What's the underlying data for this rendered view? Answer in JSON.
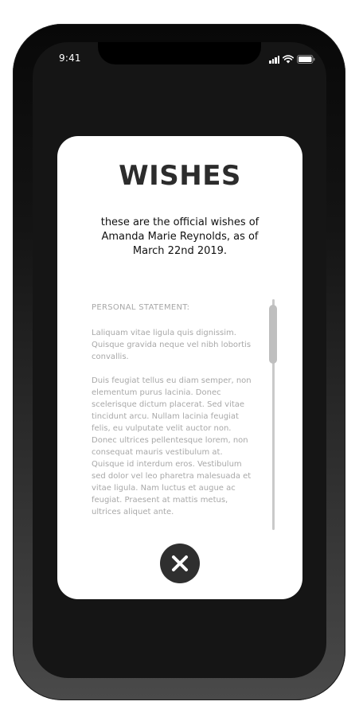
{
  "status_bar": {
    "time": "9:41",
    "signal_icon": "cellular-signal-icon",
    "wifi_icon": "wifi-icon",
    "battery_icon": "battery-icon"
  },
  "modal": {
    "title": "WISHES",
    "subtitle": "these are the official wishes of Amanda Marie Reynolds, as of March 22nd 2019.",
    "statement_heading": "PERSONAL STATEMENT:",
    "paragraphs": [
      "Laliquam vitae ligula quis dignissim. Quisque gravida neque vel nibh lobortis convallis.",
      "Duis feugiat tellus eu diam semper, non elementum purus lacinia. Donec scelerisque dictum placerat. Sed vitae tincidunt arcu. Nullam lacinia feugiat felis, eu vulputate velit auctor non. Donec ultrices pellentesque lorem, non consequat mauris vestibulum at. Quisque id interdum eros. Vestibulum sed dolor vel leo pharetra malesuada et vitae ligula. Nam luctus et augue ac feugiat. Praesent at mattis metus, ultrices aliquet ante."
    ],
    "close_icon": "close-icon"
  },
  "colors": {
    "modal_background": "#ffffff",
    "title_color": "#2c2c2c",
    "body_text_color": "#a8a8a8",
    "close_button_color": "#2f2f2f",
    "screen_background": "#151515"
  }
}
